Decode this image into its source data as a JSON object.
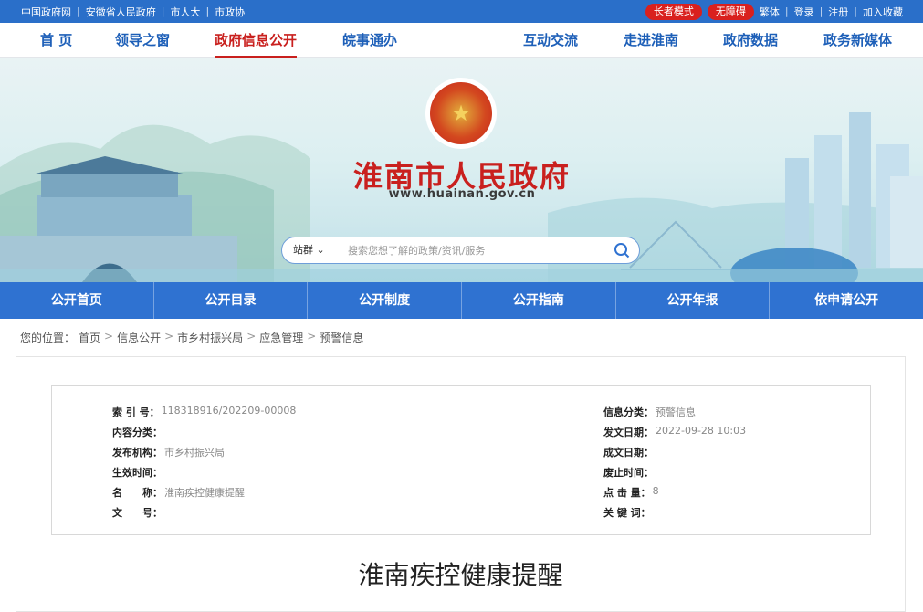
{
  "topbar": {
    "links": [
      "中国政府网",
      "安徽省人民政府",
      "市人大",
      "市政协"
    ],
    "elder_mode": "长者模式",
    "accessibility": "无障碍",
    "traditional": "繁体",
    "login": "登录",
    "register": "注册",
    "bookmark": "加入收藏"
  },
  "mainnav": {
    "items": [
      "首 页",
      "领导之窗",
      "政府信息公开",
      "皖事通办",
      "互动交流",
      "走进淮南",
      "政府数据",
      "政务新媒体"
    ],
    "active": "政府信息公开"
  },
  "banner": {
    "title": "淮南市人民政府",
    "url": "www.huainan.gov.cn"
  },
  "search": {
    "scope": "站群",
    "placeholder": "搜索您想了解的政策/资讯/服务"
  },
  "secnav": {
    "items": [
      "公开首页",
      "公开目录",
      "公开制度",
      "公开指南",
      "公开年报",
      "依申请公开"
    ]
  },
  "breadcrumb": {
    "prefix": "您的位置：",
    "items": [
      "首页",
      "信息公开",
      "市乡村振兴局",
      "应急管理",
      "预警信息"
    ]
  },
  "meta": {
    "index_no_label": "索 引 号：",
    "index_no": "118318916/202209-00008",
    "content_cat_label": "内容分类：",
    "content_cat": "",
    "publisher_label": "发布机构：",
    "publisher": "市乡村振兴局",
    "effective_label": "生效时间：",
    "effective": "",
    "name_label": "名　　称：",
    "name": "淮南疾控健康提醒",
    "docno_label": "文　　号：",
    "docno": "",
    "info_cat_label": "信息分类：",
    "info_cat": "预警信息",
    "issue_date_label": "发文日期：",
    "issue_date": "2022-09-28 10:03",
    "written_date_label": "成文日期：",
    "written_date": "",
    "expire_label": "废止时间：",
    "expire": "",
    "clicks_label": "点 击 量：",
    "clicks": "8",
    "keywords_label": "关 键 词：",
    "keywords": ""
  },
  "article": {
    "title": "淮南疾控健康提醒"
  }
}
